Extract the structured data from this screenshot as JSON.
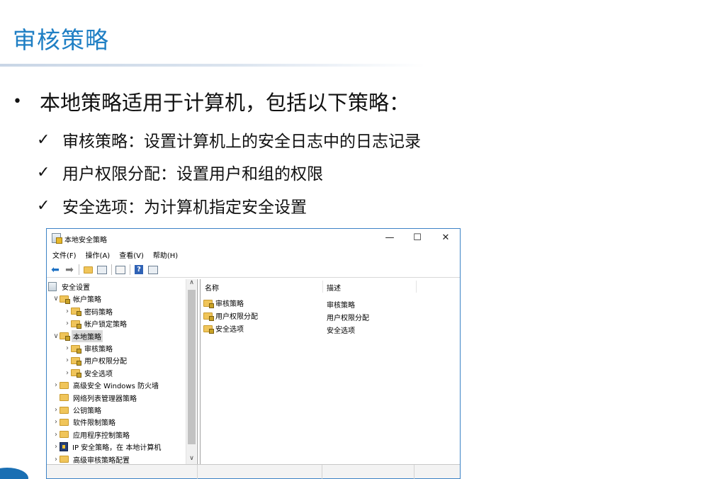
{
  "slide": {
    "title": "审核策略",
    "bullet": "本地策略适用于计算机，包括以下策略：",
    "bullet_marker": "•",
    "check_marker": "✓",
    "subitems": [
      "审核策略：设置计算机上的安全日志中的日志记录",
      "用户权限分配：设置用户和组的权限",
      "安全选项：为计算机指定安全设置"
    ],
    "title_color": "#1f7fc4"
  },
  "window": {
    "title": "本地安全策略",
    "controls": {
      "minimize": "—",
      "maximize": "☐",
      "close": "✕"
    },
    "menu": [
      "文件(F)",
      "操作(A)",
      "查看(V)",
      "帮助(H)"
    ],
    "toolbar_icons": [
      "back-arrow-icon",
      "forward-arrow-icon",
      "up-folder-icon",
      "show-tree-icon",
      "export-list-icon",
      "help-icon",
      "properties-icon"
    ],
    "tree": [
      {
        "label": "安全设置",
        "expander": "",
        "icon": "root",
        "indent": 0
      },
      {
        "label": "帐户策略",
        "expander": "∨",
        "icon": "folder-lock",
        "indent": 1
      },
      {
        "label": "密码策略",
        "expander": "›",
        "icon": "folder-lock",
        "indent": 2
      },
      {
        "label": "帐户锁定策略",
        "expander": "›",
        "icon": "folder-lock",
        "indent": 2
      },
      {
        "label": "本地策略",
        "expander": "∨",
        "icon": "folder-lock",
        "indent": 1,
        "selected": true
      },
      {
        "label": "审核策略",
        "expander": "›",
        "icon": "folder-lock",
        "indent": 2
      },
      {
        "label": "用户权限分配",
        "expander": "›",
        "icon": "folder-lock",
        "indent": 2
      },
      {
        "label": "安全选项",
        "expander": "›",
        "icon": "folder-lock",
        "indent": 2
      },
      {
        "label": "高级安全 Windows 防火墙",
        "expander": "›",
        "icon": "folder",
        "indent": 1
      },
      {
        "label": "网络列表管理器策略",
        "expander": "",
        "icon": "folder",
        "indent": 1
      },
      {
        "label": "公钥策略",
        "expander": "›",
        "icon": "folder",
        "indent": 1
      },
      {
        "label": "软件限制策略",
        "expander": "›",
        "icon": "folder",
        "indent": 1
      },
      {
        "label": "应用程序控制策略",
        "expander": "›",
        "icon": "folder",
        "indent": 1
      },
      {
        "label": "IP 安全策略，在 本地计算机",
        "expander": "›",
        "icon": "ip",
        "indent": 1
      },
      {
        "label": "高级审核策略配置",
        "expander": "›",
        "icon": "folder",
        "indent": 1
      }
    ],
    "scroll": {
      "up": "∧",
      "down": "∨"
    },
    "columns": {
      "name": "名称",
      "desc": "描述",
      "sort_caret": "^"
    },
    "rows": [
      {
        "name": "审核策略",
        "desc": "审核策略"
      },
      {
        "name": "用户权限分配",
        "desc": "用户权限分配"
      },
      {
        "name": "安全选项",
        "desc": "安全选项"
      }
    ]
  }
}
